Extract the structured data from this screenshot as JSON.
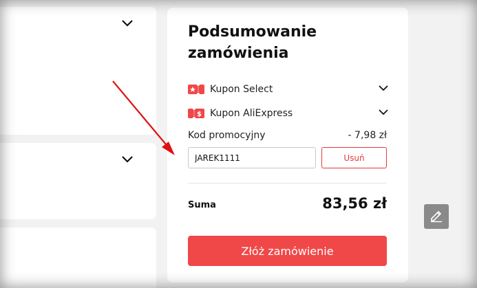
{
  "summary": {
    "title": "Podsumowanie zamówienia",
    "coupons": [
      {
        "label": "Kupon Select",
        "icon": "select-coupon-icon"
      },
      {
        "label": "Kupon AliExpress",
        "icon": "aliexpress-coupon-icon"
      }
    ],
    "promo_label": "Kod promocyjny",
    "promo_discount": "- 7,98 zł",
    "promo_code_value": "JAREK1111",
    "remove_label": "Usuń",
    "total_label": "Suma",
    "total_value": "83,56 zł",
    "order_button_label": "Złóż zamówienie"
  },
  "colors": {
    "accent": "#f04848",
    "remove_border": "#e23b3b",
    "annotation_arrow": "#e01010"
  },
  "icons": {
    "left_card_1": "chevron-down-icon",
    "left_card_2": "chevron-down-icon",
    "edit_button": "pencil-icon"
  }
}
